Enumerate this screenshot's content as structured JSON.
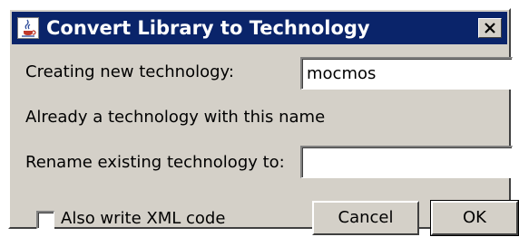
{
  "window": {
    "title": "Convert Library to Technology",
    "app_icon": "java-coffee-icon",
    "close_icon": "close-icon"
  },
  "form": {
    "new_tech_label": "Creating new technology:",
    "new_tech_value": "mocmos",
    "warning_text": "Already a technology with this name",
    "rename_label": "Rename existing technology to:",
    "rename_value": "",
    "xml_checkbox_label": "Also write XML code",
    "xml_checkbox_checked": false
  },
  "buttons": {
    "cancel_label": "Cancel",
    "ok_label": "OK"
  },
  "colors": {
    "titlebar": "#0a246a",
    "dialog_bg": "#d4d0c8"
  }
}
